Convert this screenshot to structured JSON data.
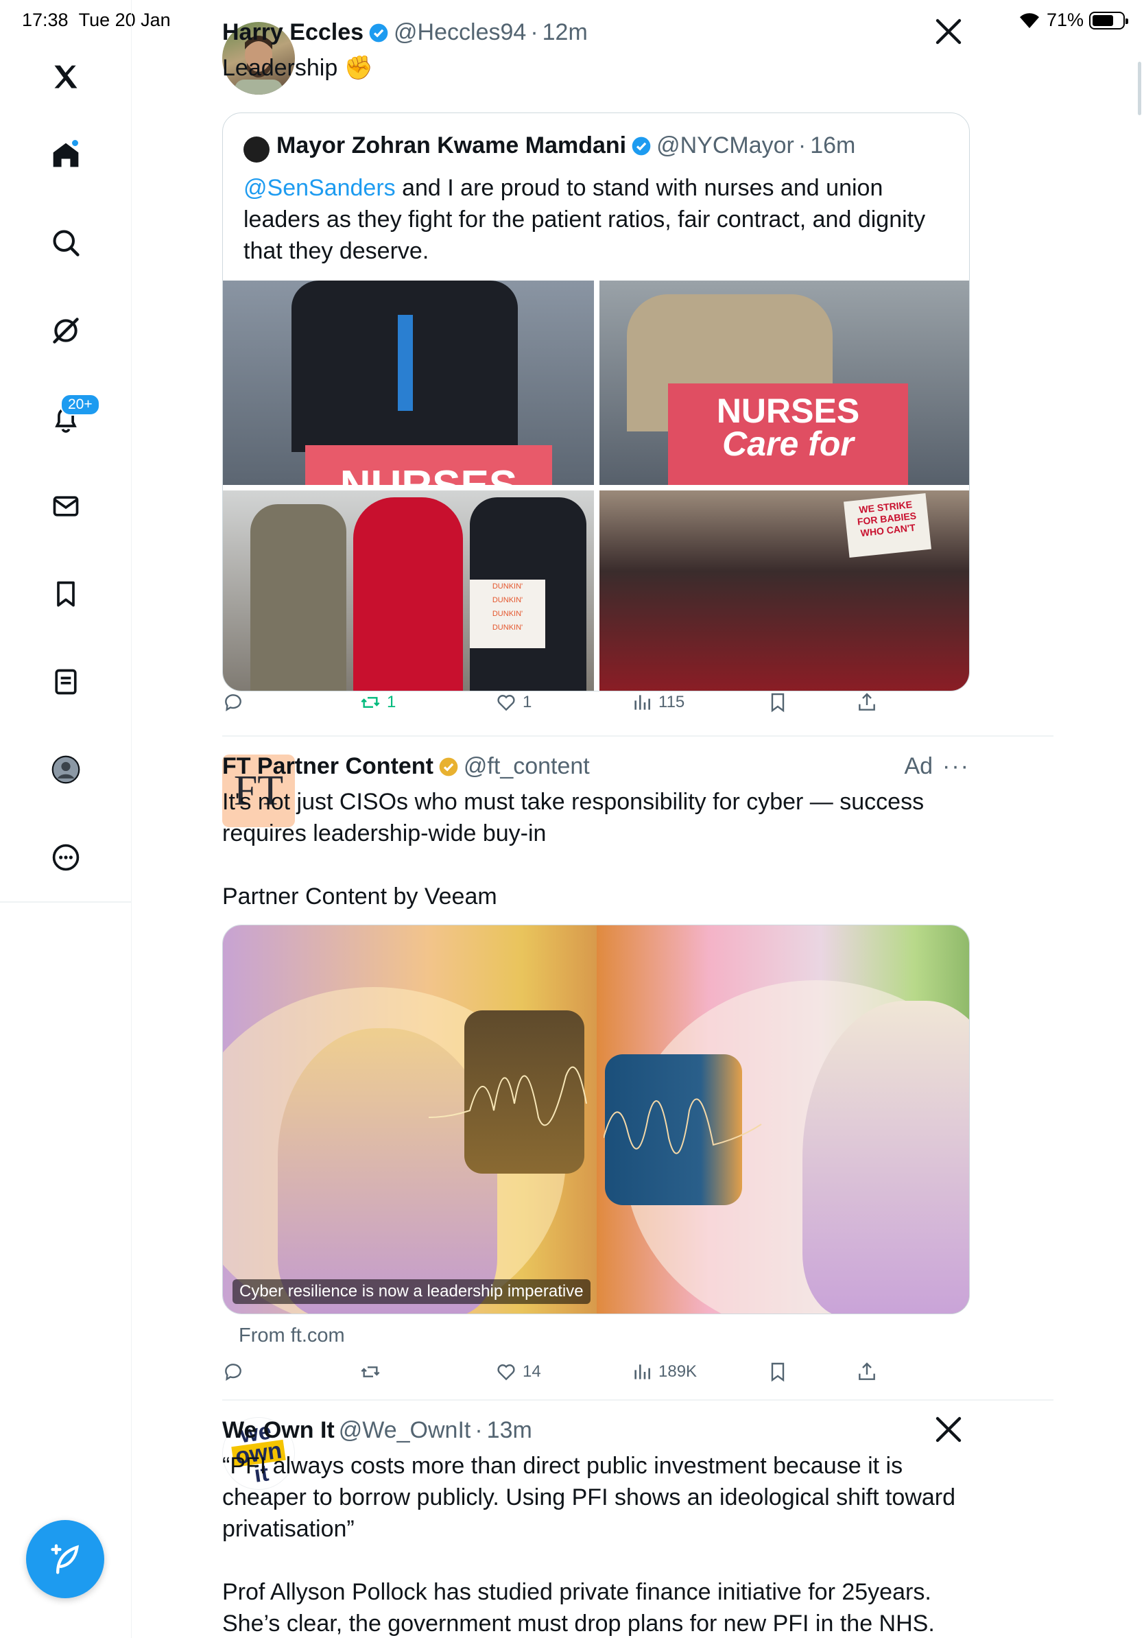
{
  "status_bar": {
    "time": "17:38",
    "date": "Tue 20 Jan",
    "battery": "71%"
  },
  "sidebar": {
    "items": [
      {
        "name": "x-logo",
        "label": "X"
      },
      {
        "name": "home",
        "label": "Home"
      },
      {
        "name": "search",
        "label": "Search"
      },
      {
        "name": "grok",
        "label": "Grok"
      },
      {
        "name": "notifications",
        "label": "Notifications",
        "badge": "20+"
      },
      {
        "name": "messages",
        "label": "Messages"
      },
      {
        "name": "bookmarks",
        "label": "Bookmarks"
      },
      {
        "name": "lists",
        "label": "Lists"
      },
      {
        "name": "profile",
        "label": "Profile"
      },
      {
        "name": "more",
        "label": "More"
      }
    ],
    "compose_label": "Post"
  },
  "colors": {
    "accent": "#1d9bf0",
    "text": "#0f1419",
    "muted": "#536471",
    "repost": "#00ba7c",
    "gold": "#e8b130"
  },
  "tweets": [
    {
      "name": "Harry Eccles",
      "handle": "@Heccles94",
      "time": "12m",
      "text": "Leadership ✊",
      "quote": {
        "name": "Mayor Zohran Kwame Mamdani",
        "handle": "@NYCMayor",
        "time": "16m",
        "mention": "@SenSanders",
        "text": " and I are proud to stand with nurses and union leaders as they fight for the patient ratios, fair contract, and dignity that they deserve.",
        "sign_text": "NURSES",
        "sign_text_2": "Care for",
        "strike_sign": "WE STRIKE FOR BABIES WHO CAN'T",
        "box_text": "DUNKIN'"
      },
      "stats": {
        "replies": "",
        "reposts": "1",
        "likes": "1",
        "views": "115"
      }
    },
    {
      "name": "FT Partner Content",
      "handle": "@ft_content",
      "ad_label": "Ad",
      "logo_text": "FT",
      "text": "It's not just CISOs who must take responsibility for cyber — success requires leadership-wide buy-in",
      "text2": "Partner Content by Veeam",
      "media_caption": "Cyber resilience is now a leadership imperative",
      "source": "From ft.com",
      "stats": {
        "replies": "",
        "reposts": "",
        "likes": "14",
        "views": "189K"
      }
    },
    {
      "name": "We Own It",
      "handle": "@We_OwnIt",
      "time": "13m",
      "logo_text": [
        "we",
        "own",
        "it"
      ],
      "text": "“PFI always costs more than direct public investment because it is cheaper to borrow publicly. Using PFI shows an ideological shift toward privatisation”",
      "text2": "Prof Allyson Pollock has studied private finance initiative for 25years. She’s clear, the government must drop plans for new PFI in the NHS."
    }
  ]
}
